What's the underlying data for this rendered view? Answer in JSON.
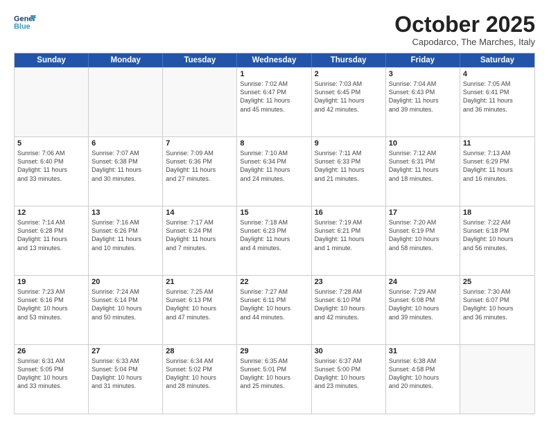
{
  "header": {
    "logo_line1": "General",
    "logo_line2": "Blue",
    "month": "October 2025",
    "location": "Capodarco, The Marches, Italy"
  },
  "weekdays": [
    "Sunday",
    "Monday",
    "Tuesday",
    "Wednesday",
    "Thursday",
    "Friday",
    "Saturday"
  ],
  "weeks": [
    [
      {
        "day": "",
        "info": ""
      },
      {
        "day": "",
        "info": ""
      },
      {
        "day": "",
        "info": ""
      },
      {
        "day": "1",
        "info": "Sunrise: 7:02 AM\nSunset: 6:47 PM\nDaylight: 11 hours\nand 45 minutes."
      },
      {
        "day": "2",
        "info": "Sunrise: 7:03 AM\nSunset: 6:45 PM\nDaylight: 11 hours\nand 42 minutes."
      },
      {
        "day": "3",
        "info": "Sunrise: 7:04 AM\nSunset: 6:43 PM\nDaylight: 11 hours\nand 39 minutes."
      },
      {
        "day": "4",
        "info": "Sunrise: 7:05 AM\nSunset: 6:41 PM\nDaylight: 11 hours\nand 36 minutes."
      }
    ],
    [
      {
        "day": "5",
        "info": "Sunrise: 7:06 AM\nSunset: 6:40 PM\nDaylight: 11 hours\nand 33 minutes."
      },
      {
        "day": "6",
        "info": "Sunrise: 7:07 AM\nSunset: 6:38 PM\nDaylight: 11 hours\nand 30 minutes."
      },
      {
        "day": "7",
        "info": "Sunrise: 7:09 AM\nSunset: 6:36 PM\nDaylight: 11 hours\nand 27 minutes."
      },
      {
        "day": "8",
        "info": "Sunrise: 7:10 AM\nSunset: 6:34 PM\nDaylight: 11 hours\nand 24 minutes."
      },
      {
        "day": "9",
        "info": "Sunrise: 7:11 AM\nSunset: 6:33 PM\nDaylight: 11 hours\nand 21 minutes."
      },
      {
        "day": "10",
        "info": "Sunrise: 7:12 AM\nSunset: 6:31 PM\nDaylight: 11 hours\nand 18 minutes."
      },
      {
        "day": "11",
        "info": "Sunrise: 7:13 AM\nSunset: 6:29 PM\nDaylight: 11 hours\nand 16 minutes."
      }
    ],
    [
      {
        "day": "12",
        "info": "Sunrise: 7:14 AM\nSunset: 6:28 PM\nDaylight: 11 hours\nand 13 minutes."
      },
      {
        "day": "13",
        "info": "Sunrise: 7:16 AM\nSunset: 6:26 PM\nDaylight: 11 hours\nand 10 minutes."
      },
      {
        "day": "14",
        "info": "Sunrise: 7:17 AM\nSunset: 6:24 PM\nDaylight: 11 hours\nand 7 minutes."
      },
      {
        "day": "15",
        "info": "Sunrise: 7:18 AM\nSunset: 6:23 PM\nDaylight: 11 hours\nand 4 minutes."
      },
      {
        "day": "16",
        "info": "Sunrise: 7:19 AM\nSunset: 6:21 PM\nDaylight: 11 hours\nand 1 minute."
      },
      {
        "day": "17",
        "info": "Sunrise: 7:20 AM\nSunset: 6:19 PM\nDaylight: 10 hours\nand 58 minutes."
      },
      {
        "day": "18",
        "info": "Sunrise: 7:22 AM\nSunset: 6:18 PM\nDaylight: 10 hours\nand 56 minutes."
      }
    ],
    [
      {
        "day": "19",
        "info": "Sunrise: 7:23 AM\nSunset: 6:16 PM\nDaylight: 10 hours\nand 53 minutes."
      },
      {
        "day": "20",
        "info": "Sunrise: 7:24 AM\nSunset: 6:14 PM\nDaylight: 10 hours\nand 50 minutes."
      },
      {
        "day": "21",
        "info": "Sunrise: 7:25 AM\nSunset: 6:13 PM\nDaylight: 10 hours\nand 47 minutes."
      },
      {
        "day": "22",
        "info": "Sunrise: 7:27 AM\nSunset: 6:11 PM\nDaylight: 10 hours\nand 44 minutes."
      },
      {
        "day": "23",
        "info": "Sunrise: 7:28 AM\nSunset: 6:10 PM\nDaylight: 10 hours\nand 42 minutes."
      },
      {
        "day": "24",
        "info": "Sunrise: 7:29 AM\nSunset: 6:08 PM\nDaylight: 10 hours\nand 39 minutes."
      },
      {
        "day": "25",
        "info": "Sunrise: 7:30 AM\nSunset: 6:07 PM\nDaylight: 10 hours\nand 36 minutes."
      }
    ],
    [
      {
        "day": "26",
        "info": "Sunrise: 6:31 AM\nSunset: 5:05 PM\nDaylight: 10 hours\nand 33 minutes."
      },
      {
        "day": "27",
        "info": "Sunrise: 6:33 AM\nSunset: 5:04 PM\nDaylight: 10 hours\nand 31 minutes."
      },
      {
        "day": "28",
        "info": "Sunrise: 6:34 AM\nSunset: 5:02 PM\nDaylight: 10 hours\nand 28 minutes."
      },
      {
        "day": "29",
        "info": "Sunrise: 6:35 AM\nSunset: 5:01 PM\nDaylight: 10 hours\nand 25 minutes."
      },
      {
        "day": "30",
        "info": "Sunrise: 6:37 AM\nSunset: 5:00 PM\nDaylight: 10 hours\nand 23 minutes."
      },
      {
        "day": "31",
        "info": "Sunrise: 6:38 AM\nSunset: 4:58 PM\nDaylight: 10 hours\nand 20 minutes."
      },
      {
        "day": "",
        "info": ""
      }
    ]
  ]
}
